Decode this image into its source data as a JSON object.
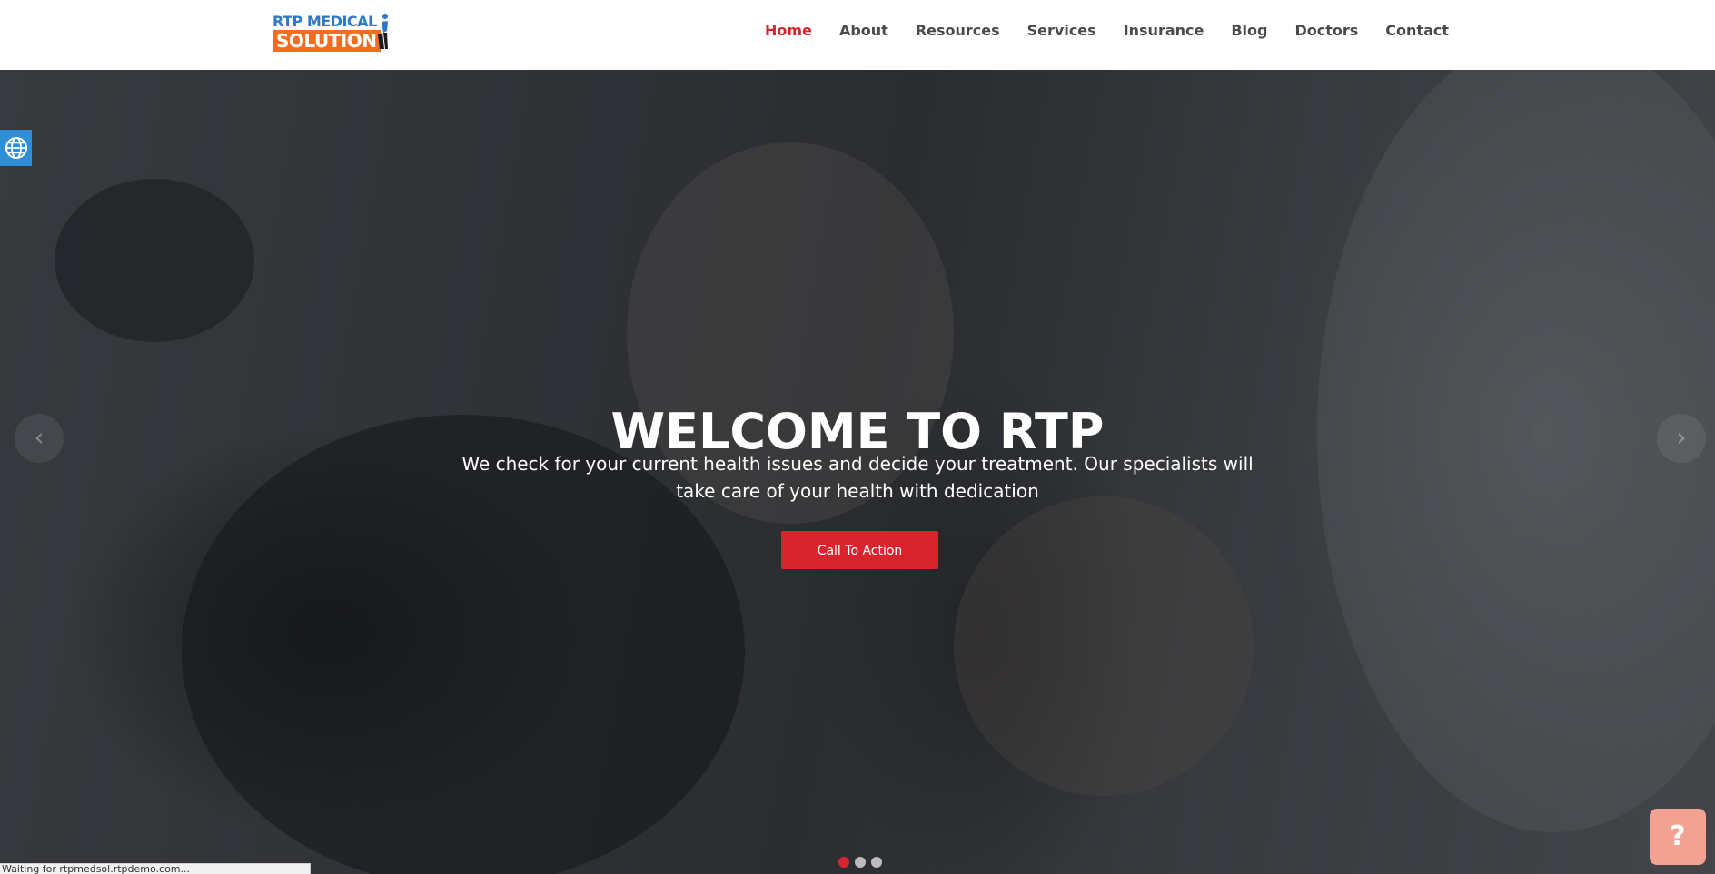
{
  "header": {
    "logo": {
      "top_text": "RTP MEDICAL",
      "bottom_text": "SOLUTION",
      "alt": "RTP Medical Solution"
    },
    "nav": [
      {
        "label": "Home",
        "active": true
      },
      {
        "label": "About"
      },
      {
        "label": "Resources"
      },
      {
        "label": "Services"
      },
      {
        "label": "Insurance"
      },
      {
        "label": "Blog"
      },
      {
        "label": "Doctors"
      },
      {
        "label": "Contact"
      }
    ]
  },
  "hero": {
    "title": "WELCOME TO RTP",
    "text": "We check for your current health issues and decide your treatment. Our specialists will take care of your health with dedication",
    "cta_label": "Call To Action",
    "prev_icon": "chevron-left-icon",
    "next_icon": "chevron-right-icon",
    "prev_glyph": "‹",
    "next_glyph": "›",
    "slides_count": 3,
    "active_slide": 1
  },
  "widgets": {
    "language_icon": "globe-icon",
    "help_icon": "question-icon",
    "help_glyph": "?"
  },
  "status_bar": {
    "text": "Waiting for rtpmedsol.rtpdemo.com..."
  },
  "colors": {
    "accent": "#d9232d",
    "logo_blue": "#2f78c4",
    "logo_orange": "#f26d21",
    "globe_bg": "#2f8fd6",
    "help_bg": "#f3a191"
  }
}
